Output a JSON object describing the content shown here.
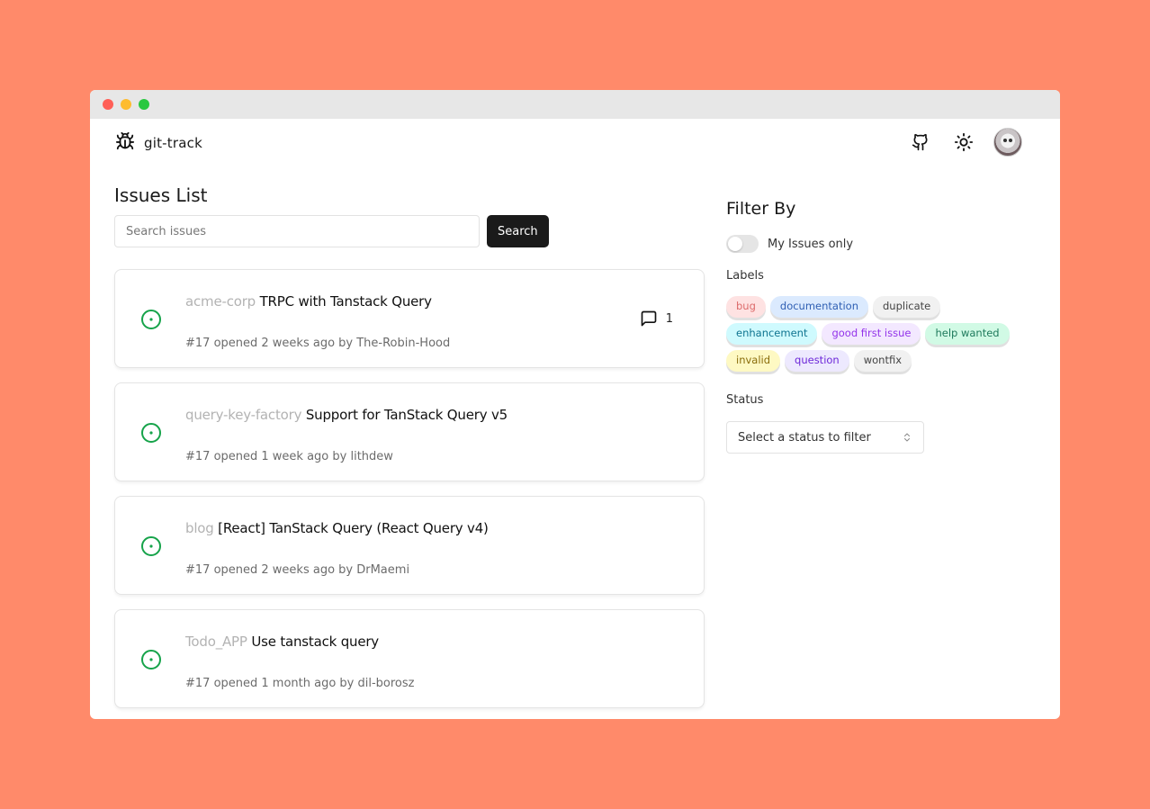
{
  "app": {
    "name": "git-track"
  },
  "nav": {
    "icons": [
      "bug-icon",
      "github-icon",
      "sun-icon",
      "avatar"
    ]
  },
  "issues_list": {
    "title": "Issues List",
    "search_placeholder": "Search issues",
    "search_button": "Search",
    "items": [
      {
        "repo": "acme-corp",
        "title": "TRPC with Tanstack Query",
        "meta": "#17 opened 2 weeks ago by The-Robin-Hood",
        "comments": "1",
        "status_color": "#16A34A"
      },
      {
        "repo": "query-key-factory",
        "title": "Support for TanStack Query v5",
        "meta": "#17 opened 1 week ago by lithdew",
        "comments": "",
        "status_color": "#16A34A"
      },
      {
        "repo": "blog",
        "title": "[React] TanStack Query (React Query v4)",
        "meta": "#17 opened 2 weeks ago by DrMaemi",
        "comments": "",
        "status_color": "#16A34A"
      },
      {
        "repo": "Todo_APP",
        "title": "Use tanstack query",
        "meta": "#17 opened 1 month ago by dil-borosz",
        "comments": "",
        "status_color": "#16A34A"
      }
    ]
  },
  "filter": {
    "title": "Filter By",
    "my_issues_label": "My Issues only",
    "my_issues_on": false,
    "labels_title": "Labels",
    "labels": [
      {
        "name": "bug",
        "bg": "#FEE2E2",
        "fg": "#DC6B6B"
      },
      {
        "name": "documentation",
        "bg": "#DBEAFE",
        "fg": "#2F5FB3"
      },
      {
        "name": "duplicate",
        "bg": "#F1F1F1",
        "fg": "#444444"
      },
      {
        "name": "enhancement",
        "bg": "#CFFAFE",
        "fg": "#0E7490"
      },
      {
        "name": "good first issue",
        "bg": "#F3E8FF",
        "fg": "#9333EA"
      },
      {
        "name": "help wanted",
        "bg": "#D1FAE5",
        "fg": "#1F7A5C"
      },
      {
        "name": "invalid",
        "bg": "#FEF9C3",
        "fg": "#8A6D0B"
      },
      {
        "name": "question",
        "bg": "#EDE9FE",
        "fg": "#6D28D9"
      },
      {
        "name": "wontfix",
        "bg": "#F1F1F1",
        "fg": "#444444"
      }
    ],
    "status_title": "Status",
    "status_select": "Select a status to filter"
  }
}
